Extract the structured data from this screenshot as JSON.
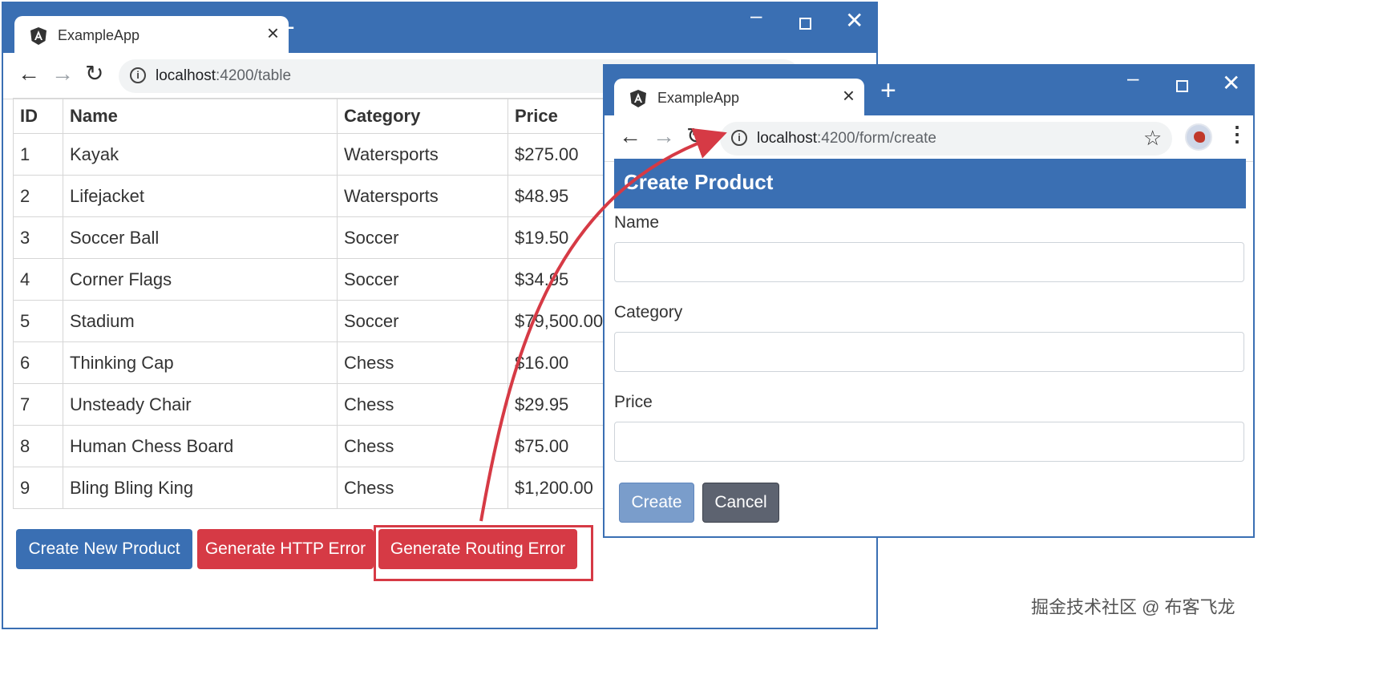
{
  "table_window": {
    "tab_title": "ExampleApp",
    "url_host": "localhost",
    "url_rest": ":4200/table",
    "columns": [
      "ID",
      "Name",
      "Category",
      "Price"
    ],
    "rows": [
      [
        "1",
        "Kayak",
        "Watersports",
        "$275.00"
      ],
      [
        "2",
        "Lifejacket",
        "Watersports",
        "$48.95"
      ],
      [
        "3",
        "Soccer Ball",
        "Soccer",
        "$19.50"
      ],
      [
        "4",
        "Corner Flags",
        "Soccer",
        "$34.95"
      ],
      [
        "5",
        "Stadium",
        "Soccer",
        "$79,500.00"
      ],
      [
        "6",
        "Thinking Cap",
        "Chess",
        "$16.00"
      ],
      [
        "7",
        "Unsteady Chair",
        "Chess",
        "$29.95"
      ],
      [
        "8",
        "Human Chess Board",
        "Chess",
        "$75.00"
      ],
      [
        "9",
        "Bling Bling King",
        "Chess",
        "$1,200.00"
      ]
    ],
    "buttons": {
      "create": "Create New Product",
      "http_error": "Generate HTTP Error",
      "routing_error": "Generate Routing Error"
    }
  },
  "form_window": {
    "tab_title": "ExampleApp",
    "url_host": "localhost",
    "url_rest": ":4200/form/create",
    "header": "Create Product",
    "labels": {
      "name": "Name",
      "category": "Category",
      "price": "Price"
    },
    "buttons": {
      "create": "Create",
      "cancel": "Cancel"
    }
  },
  "icons": {
    "angular": "angular-logo-icon",
    "close": "close-icon",
    "new_tab": "plus-icon",
    "back": "back-arrow-icon",
    "forward": "forward-arrow-icon",
    "reload": "reload-icon",
    "info": "info-icon",
    "star": "star-icon",
    "profile": "profile-avatar-icon",
    "menu": "kebab-menu-icon"
  },
  "colors": {
    "accent": "#3a6fb3",
    "danger": "#d63a45",
    "secondary": "#5d6370"
  },
  "watermark": "掘金技术社区 @ 布客飞龙"
}
